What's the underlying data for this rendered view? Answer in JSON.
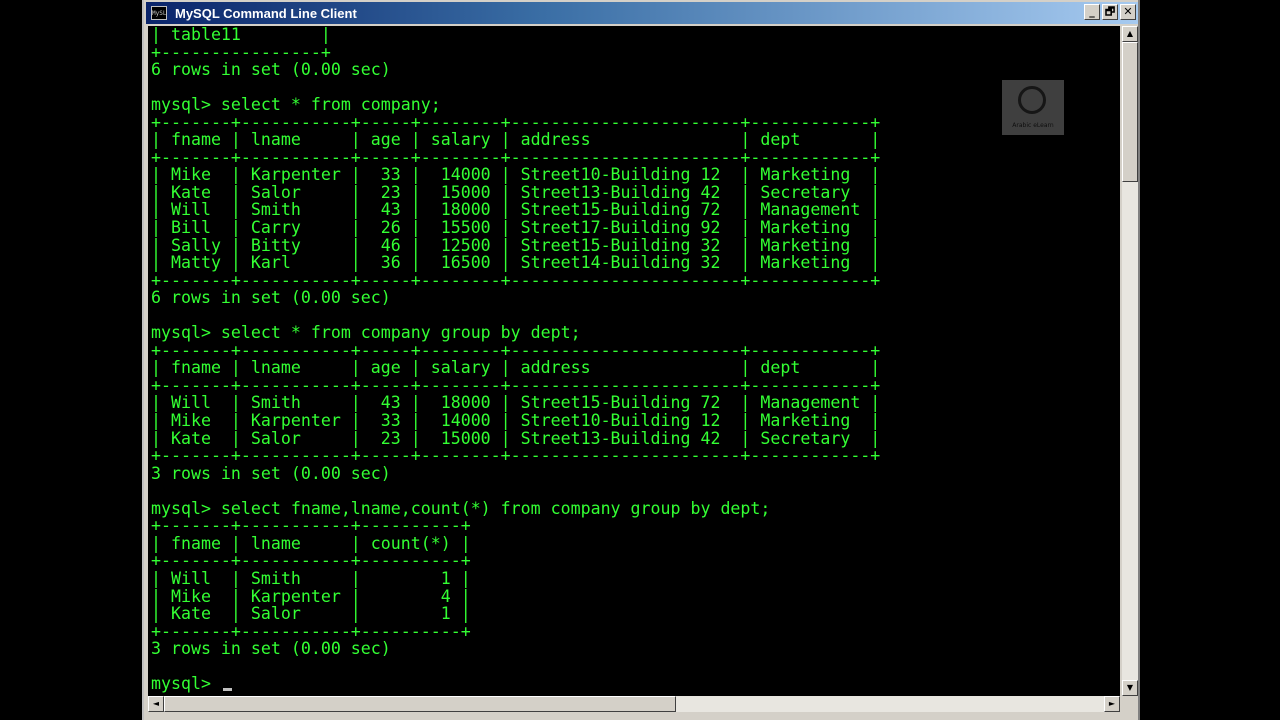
{
  "window": {
    "title": "MySQL Command Line Client",
    "icon": "mysql-console-icon",
    "icon_text": "MySL",
    "buttons": {
      "minimize": "_",
      "maximize": "🗗",
      "close": "✕"
    }
  },
  "console": {
    "text_color": "#33ff33",
    "background": "#000000",
    "lines": [
      "| table11        |",
      "+----------------+",
      "6 rows in set (0.00 sec)",
      "",
      "mysql> select * from company;",
      "+-------+-----------+-----+--------+-----------------------+------------+",
      "| fname | lname     | age | salary | address               | dept       |",
      "+-------+-----------+-----+--------+-----------------------+------------+",
      "| Mike  | Karpenter |  33 |  14000 | Street10-Building 12  | Marketing  |",
      "| Kate  | Salor     |  23 |  15000 | Street13-Building 42  | Secretary  |",
      "| Will  | Smith     |  43 |  18000 | Street15-Building 72  | Management |",
      "| Bill  | Carry     |  26 |  15500 | Street17-Building 92  | Marketing  |",
      "| Sally | Bitty     |  46 |  12500 | Street15-Building 32  | Marketing  |",
      "| Matty | Karl      |  36 |  16500 | Street14-Building 32  | Marketing  |",
      "+-------+-----------+-----+--------+-----------------------+------------+",
      "6 rows in set (0.00 sec)",
      "",
      "mysql> select * from company group by dept;",
      "+-------+-----------+-----+--------+-----------------------+------------+",
      "| fname | lname     | age | salary | address               | dept       |",
      "+-------+-----------+-----+--------+-----------------------+------------+",
      "| Will  | Smith     |  43 |  18000 | Street15-Building 72  | Management |",
      "| Mike  | Karpenter |  33 |  14000 | Street10-Building 12  | Marketing  |",
      "| Kate  | Salor     |  23 |  15000 | Street13-Building 42  | Secretary  |",
      "+-------+-----------+-----+--------+-----------------------+------------+",
      "3 rows in set (0.00 sec)",
      "",
      "mysql> select fname,lname,count(*) from company group by dept;",
      "+-------+-----------+----------+",
      "| fname | lname     | count(*) |",
      "+-------+-----------+----------+",
      "| Will  | Smith     |        1 |",
      "| Mike  | Karpenter |        4 |",
      "| Kate  | Salor     |        1 |",
      "+-------+-----------+----------+",
      "3 rows in set (0.00 sec)",
      ""
    ],
    "prompt": "mysql> "
  },
  "scrollbars": {
    "vertical": {
      "up": "▲",
      "down": "▼"
    },
    "horizontal": {
      "left": "◄",
      "right": "►"
    }
  },
  "watermark": {
    "label": "Arabic eLearn"
  }
}
